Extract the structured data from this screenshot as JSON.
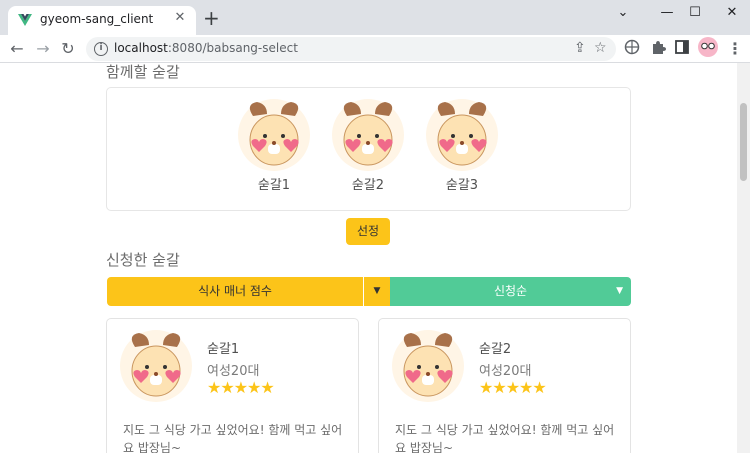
{
  "browser": {
    "tab_title": "gyeom-sang_client",
    "tab_close": "✕",
    "new_tab": "+",
    "url_host": "localhost",
    "url_path": ":8080/babsang-select",
    "minimize": "—",
    "maximize": "☐",
    "close": "✕",
    "chevron": "⌄"
  },
  "page": {
    "together_heading": "함께할 숟갈",
    "members": [
      {
        "name": "숟갈1"
      },
      {
        "name": "숟갈2"
      },
      {
        "name": "숟갈3"
      }
    ],
    "select_button": "선정",
    "applied_heading": "신청한 숟갈",
    "sort_left": "식사 매너 점수",
    "sort_right": "신청순",
    "caret": "▼",
    "cards": [
      {
        "name": "숟갈1",
        "sub": "여성20대",
        "rating": 5,
        "stars": "★★★★★",
        "message": "지도 그 식당 가고 싶었어요! 함께 먹고 싶어요 밥장님~"
      },
      {
        "name": "숟갈2",
        "sub": "여성20대",
        "rating": 5,
        "stars": "★★★★★",
        "message": "지도 그 식당 가고 싶었어요! 함께 먹고 싶어요 밥장님~"
      }
    ]
  },
  "colors": {
    "accent_yellow": "#fcc419",
    "accent_green": "#51cb97"
  }
}
